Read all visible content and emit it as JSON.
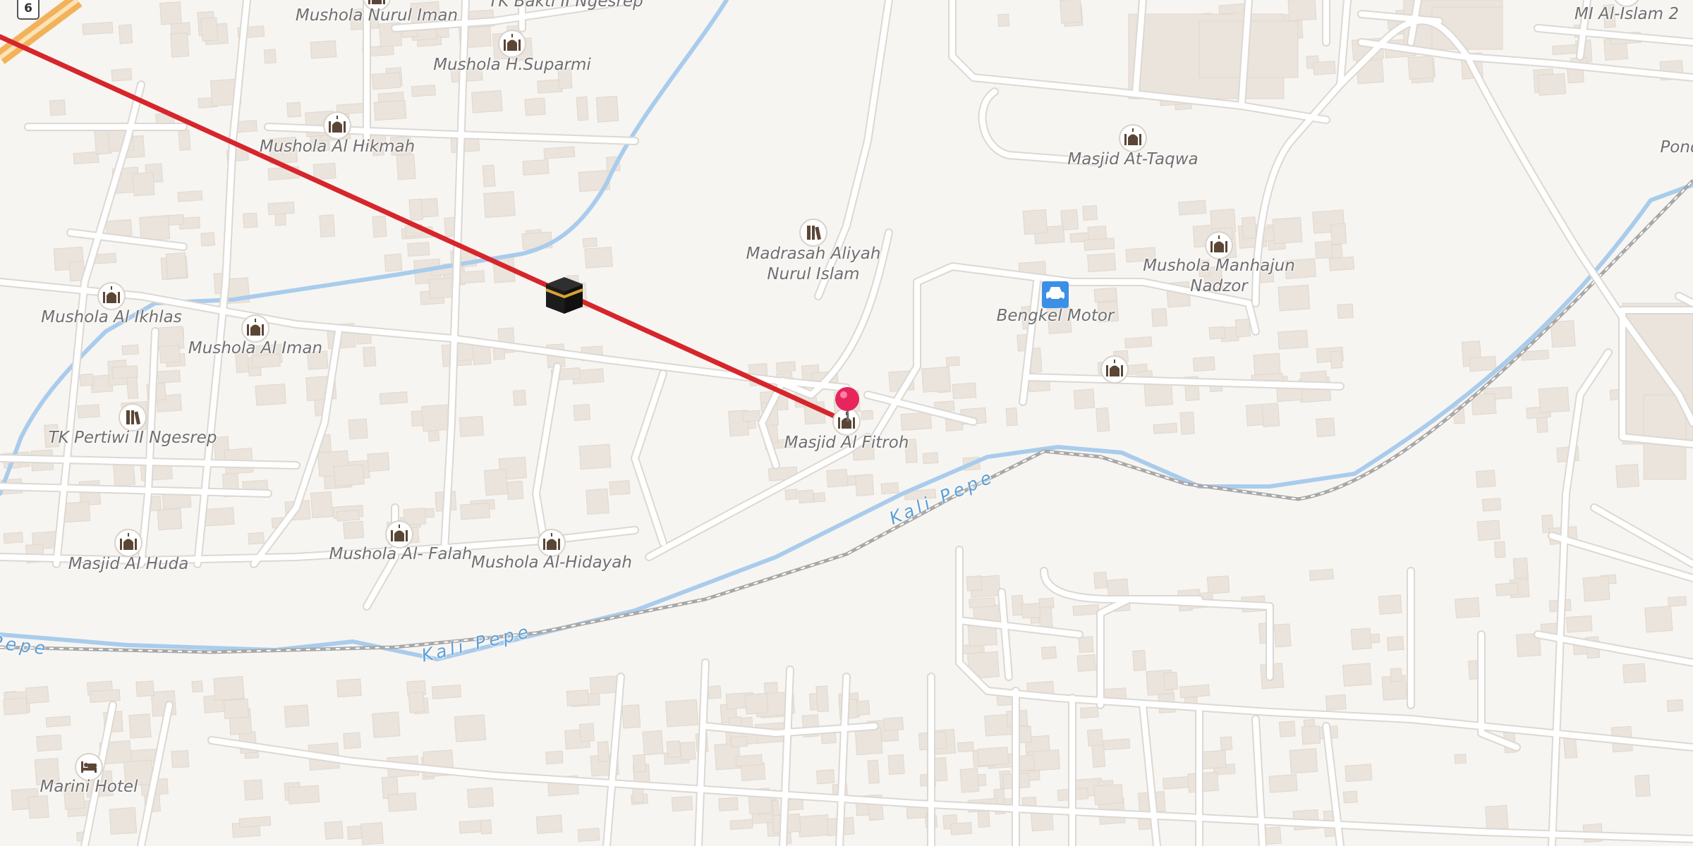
{
  "map": {
    "colors": {
      "background": "#f7f5f2",
      "road": "#ffffff",
      "road_casing": "#dcd8d2",
      "building": "#ebe4dc",
      "water": "#a9ccec",
      "railway": "#a8a8a8",
      "highway": "#f1b25a",
      "route_line": "#d6262b",
      "pin": "#e8245c",
      "poi_icon": "#5b4636",
      "car_service_icon_bg": "#3b8fe6"
    },
    "route_shield": "6",
    "pois": [
      {
        "label": "Mushola Nurul Iman",
        "icon": "mosque-icon"
      },
      {
        "label": "TK Bakti II Ngesrep",
        "icon": "school-icon"
      },
      {
        "label": "Mushola H.Suparmi",
        "icon": "mosque-icon"
      },
      {
        "label": "Mushola Al Hikmah",
        "icon": "mosque-icon"
      },
      {
        "label": "Mushola Al Ikhlas",
        "icon": "mosque-icon"
      },
      {
        "label": "Mushola Al Iman",
        "icon": "mosque-icon"
      },
      {
        "label": "TK Pertiwi II Ngesrep",
        "icon": "school-icon"
      },
      {
        "label": "Masjid Al Huda",
        "icon": "mosque-icon"
      },
      {
        "label": "Mushola Al- Falah",
        "icon": "mosque-icon"
      },
      {
        "label": "Mushola Al-Hidayah",
        "icon": "mosque-icon"
      },
      {
        "label": "Madrasah Aliyah\nNurul Islam",
        "icon": "school-icon"
      },
      {
        "label": "Masjid Al Fitroh",
        "icon": "mosque-icon"
      },
      {
        "label": "Masjid At-Taqwa",
        "icon": "mosque-icon"
      },
      {
        "label": "Mushola Manhajun\nNadzor",
        "icon": "mosque-icon"
      },
      {
        "label": "Bengkel Motor",
        "icon": "car-service-icon"
      },
      {
        "label": "",
        "icon": "mosque-icon"
      },
      {
        "label": "MI Al-Islam 2",
        "icon": "school-icon"
      },
      {
        "label": "Marini Hotel",
        "icon": "hotel-icon"
      },
      {
        "label": "Pond",
        "icon": ""
      }
    ],
    "water_labels": [
      "Kali Pepe",
      "Kali Pepe",
      "Pepe"
    ],
    "markers": {
      "destination_pin": "map-pin-icon",
      "qibla_marker": "kaaba-icon"
    }
  }
}
